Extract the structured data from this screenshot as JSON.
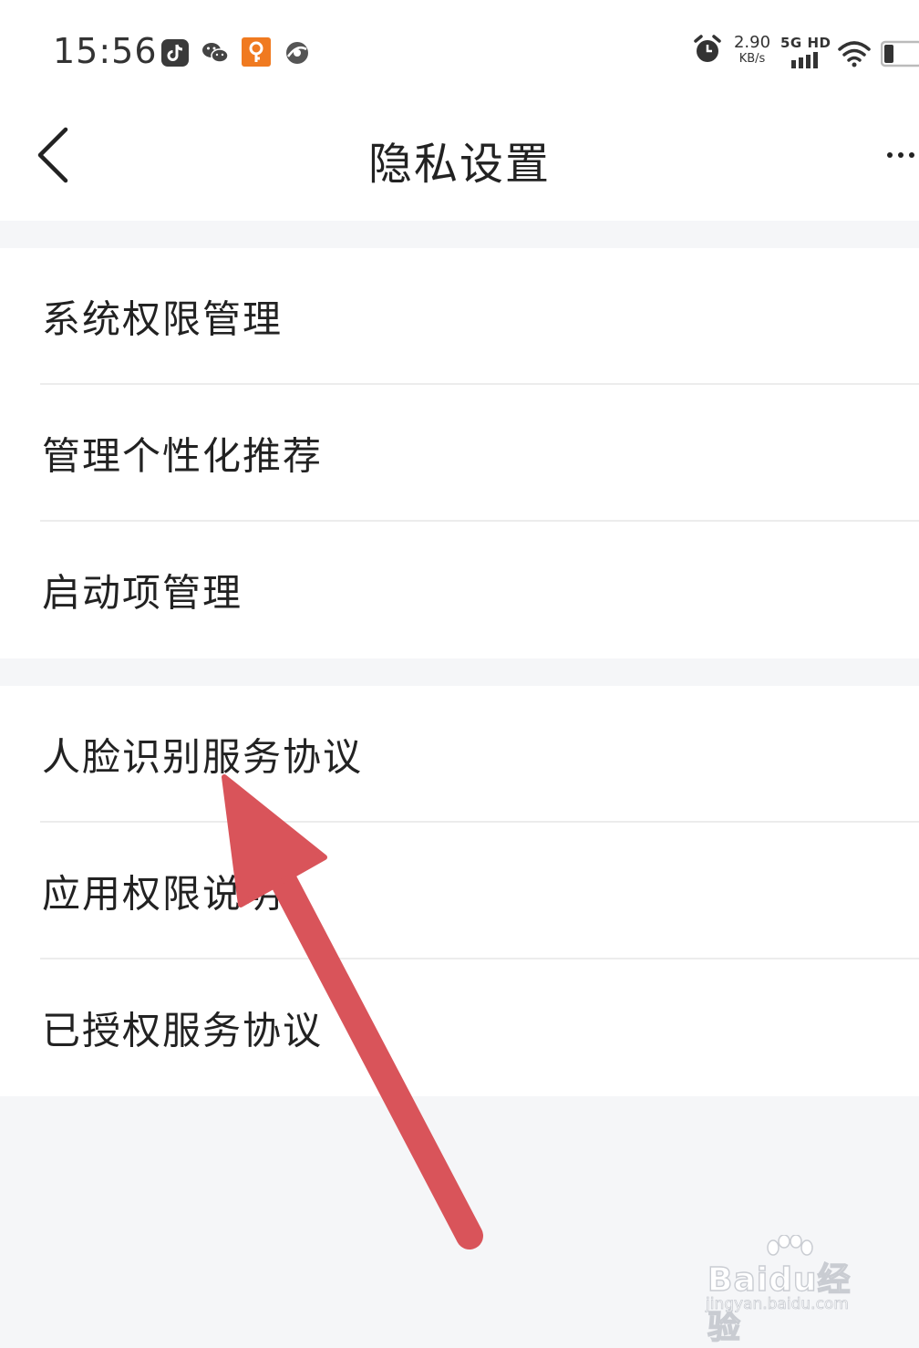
{
  "status_bar": {
    "time": "15:56",
    "net_speed_value": "2.90",
    "net_speed_unit": "KB/s",
    "network_label": "5G HD",
    "app_icons": [
      "douyin-icon",
      "wechat-icon",
      "orange-app-icon",
      "browser-icon"
    ],
    "system_icons": [
      "alarm-icon",
      "signal-icon",
      "wifi-icon",
      "battery-icon"
    ]
  },
  "header": {
    "back_icon": "chevron-left-icon",
    "title": "隐私设置",
    "more_icon": "more-icon"
  },
  "groups": [
    {
      "items": [
        {
          "label": "系统权限管理"
        },
        {
          "label": "管理个性化推荐"
        },
        {
          "label": "启动项管理"
        }
      ]
    },
    {
      "items": [
        {
          "label": "人脸识别服务协议"
        },
        {
          "label": "应用权限说明"
        },
        {
          "label": "已授权服务协议"
        }
      ]
    }
  ],
  "annotation": {
    "type": "arrow",
    "color": "#d9545a",
    "points_to": "人脸识别服务协议"
  },
  "watermark": {
    "brand": "Baidu经验",
    "url": "jingyan.baidu.com"
  },
  "colors": {
    "background": "#f5f6f8",
    "surface": "#ffffff",
    "text": "#222222",
    "divider": "#ececec"
  }
}
